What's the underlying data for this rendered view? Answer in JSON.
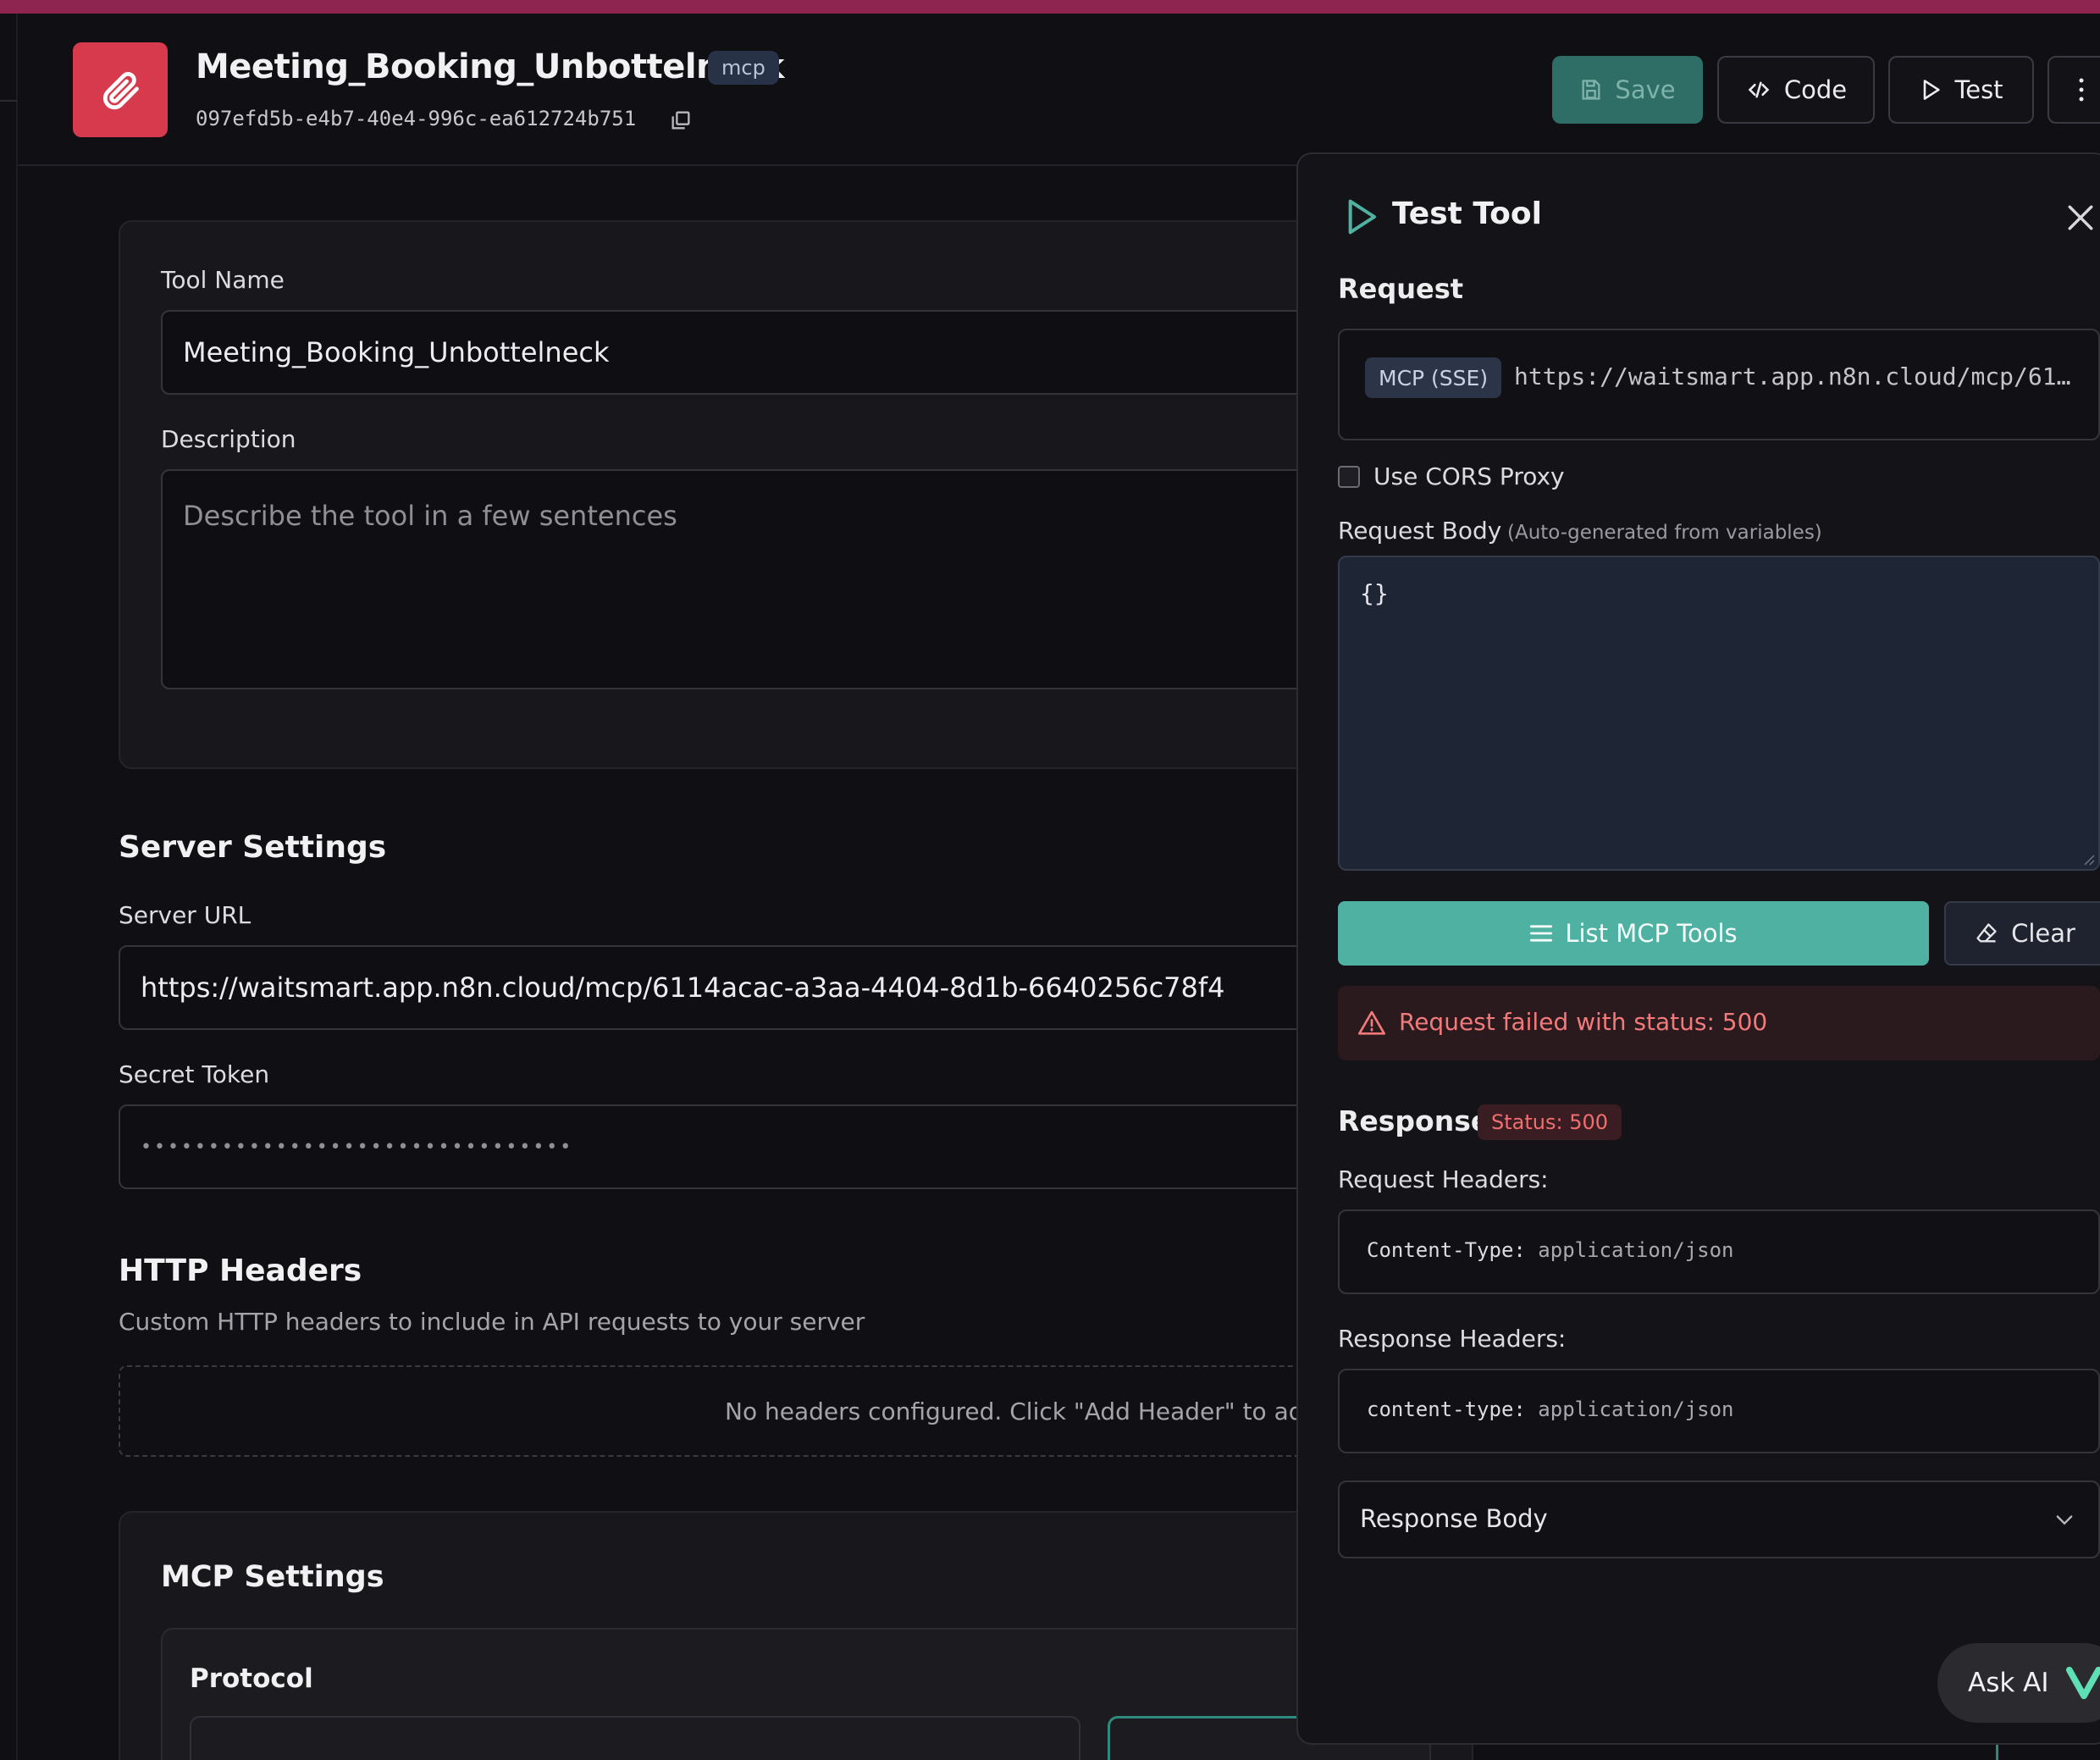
{
  "header": {
    "title": "Meeting_Booking_Unbottelneck",
    "type_badge": "mcp",
    "tool_id": "097efd5b-e4b7-40e4-996c-ea612724b751",
    "save_label": "Save",
    "code_label": "Code",
    "test_label": "Test"
  },
  "form": {
    "tool_name_label": "Tool Name",
    "tool_name_value": "Meeting_Booking_Unbottelneck",
    "description_label": "Description",
    "description_placeholder": "Describe the tool in a few sentences",
    "server_settings_title": "Server Settings",
    "server_url_label": "Server URL",
    "server_url_value": "https://waitsmart.app.n8n.cloud/mcp/6114acac-a3aa-4404-8d1b-6640256c78f4",
    "secret_token_label": "Secret Token",
    "secret_token_value": "••••••••••••••••••••••••••••••••",
    "http_headers_title": "HTTP Headers",
    "http_headers_desc": "Custom HTTP headers to include in API requests to your server",
    "no_headers_text": "No headers configured. Click \"Add Header\" to add y",
    "mcp_settings_title": "MCP Settings",
    "protocol_label": "Protocol"
  },
  "test_panel": {
    "title": "Test Tool",
    "request_title": "Request",
    "protocol_tag": "MCP (SSE)",
    "request_url": "https://waitsmart.app.n8n.cloud/mcp/61…",
    "cors_label": "Use CORS Proxy",
    "cors_checked": false,
    "body_label": "Request Body",
    "body_sublabel": "(Auto-generated from variables)",
    "body_value": "{}",
    "list_tools_label": "List MCP Tools",
    "clear_label": "Clear",
    "error_text": "Request failed with status: 500",
    "response_title": "Response",
    "status_badge": "Status: 500",
    "request_headers_label": "Request Headers:",
    "request_header_key": "Content-Type:",
    "request_header_value": "application/json",
    "response_headers_label": "Response Headers:",
    "response_header_key": "content-type:",
    "response_header_value": "application/json",
    "response_body_label": "Response Body"
  },
  "ask_ai": {
    "label": "Ask AI"
  },
  "colors": {
    "accent": "#4fb1a1",
    "brand_red": "#d83a4d",
    "error": "#f27a7a"
  },
  "icons": {
    "logo": "paperclip-icon",
    "copy": "copy-icon",
    "save": "floppy-icon",
    "code": "code-icon",
    "test": "play-icon",
    "more": "more-vertical-icon",
    "close": "close-icon",
    "list": "list-icon",
    "clear": "eraser-icon",
    "warning": "warning-icon",
    "chevron": "chevron-down-icon"
  }
}
